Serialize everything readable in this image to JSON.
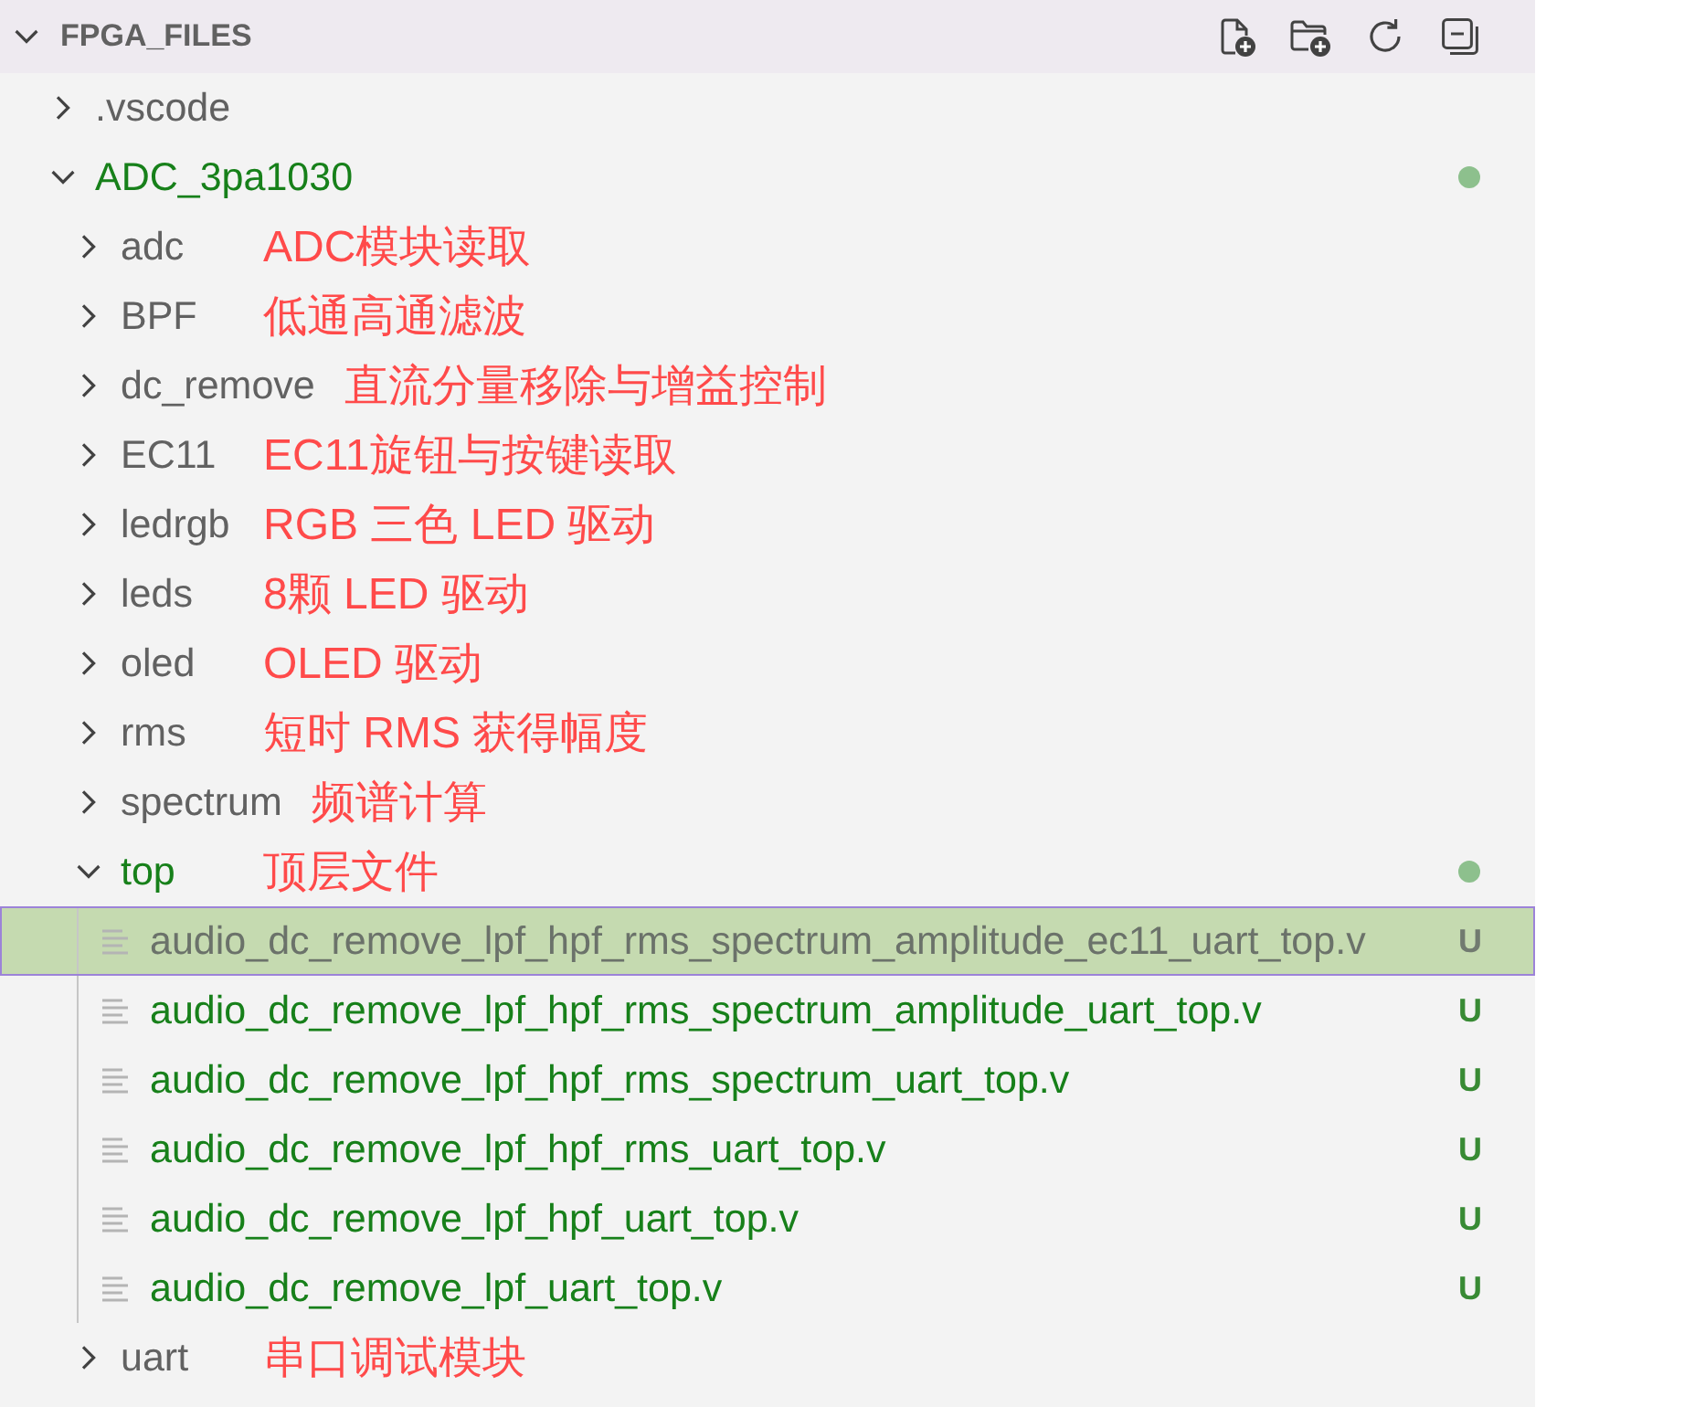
{
  "section": {
    "title": "FPGA_FILES",
    "expanded": true
  },
  "tree": [
    {
      "kind": "folder",
      "name": ".vscode",
      "expanded": false,
      "selected": false,
      "untracked": false,
      "has_changes": false
    },
    {
      "kind": "folder",
      "name": "ADC_3pa1030",
      "expanded": true,
      "selected": false,
      "untracked": true,
      "has_changes": true,
      "children": [
        {
          "kind": "folder",
          "name": "adc",
          "expanded": false,
          "selected": false,
          "untracked": false,
          "has_changes": false,
          "note": "ADC模块读取"
        },
        {
          "kind": "folder",
          "name": "BPF",
          "expanded": false,
          "selected": false,
          "untracked": false,
          "has_changes": false,
          "note": "低通高通滤波"
        },
        {
          "kind": "folder",
          "name": "dc_remove",
          "expanded": false,
          "selected": false,
          "untracked": false,
          "has_changes": false,
          "note": "直流分量移除与增益控制"
        },
        {
          "kind": "folder",
          "name": "EC11",
          "expanded": false,
          "selected": false,
          "untracked": false,
          "has_changes": false,
          "note": "EC11旋钮与按键读取"
        },
        {
          "kind": "folder",
          "name": "ledrgb",
          "expanded": false,
          "selected": false,
          "untracked": false,
          "has_changes": false,
          "note": "RGB 三色 LED 驱动"
        },
        {
          "kind": "folder",
          "name": "leds",
          "expanded": false,
          "selected": false,
          "untracked": false,
          "has_changes": false,
          "note": "8颗 LED 驱动"
        },
        {
          "kind": "folder",
          "name": "oled",
          "expanded": false,
          "selected": false,
          "untracked": false,
          "has_changes": false,
          "note": "OLED 驱动"
        },
        {
          "kind": "folder",
          "name": "rms",
          "expanded": false,
          "selected": false,
          "untracked": false,
          "has_changes": false,
          "note": "短时 RMS 获得幅度"
        },
        {
          "kind": "folder",
          "name": "spectrum",
          "expanded": false,
          "selected": false,
          "untracked": false,
          "has_changes": false,
          "note": "频谱计算"
        },
        {
          "kind": "folder",
          "name": "top",
          "expanded": true,
          "selected": false,
          "untracked": true,
          "has_changes": true,
          "note": "顶层文件",
          "children": [
            {
              "kind": "file",
              "name": "audio_dc_remove_lpf_hpf_rms_spectrum_amplitude_ec11_uart_top.v",
              "selected": true,
              "untracked": true,
              "badge": "U"
            },
            {
              "kind": "file",
              "name": "audio_dc_remove_lpf_hpf_rms_spectrum_amplitude_uart_top.v",
              "selected": false,
              "untracked": true,
              "badge": "U"
            },
            {
              "kind": "file",
              "name": "audio_dc_remove_lpf_hpf_rms_spectrum_uart_top.v",
              "selected": false,
              "untracked": true,
              "badge": "U"
            },
            {
              "kind": "file",
              "name": "audio_dc_remove_lpf_hpf_rms_uart_top.v",
              "selected": false,
              "untracked": true,
              "badge": "U"
            },
            {
              "kind": "file",
              "name": "audio_dc_remove_lpf_hpf_uart_top.v",
              "selected": false,
              "untracked": true,
              "badge": "U"
            },
            {
              "kind": "file",
              "name": "audio_dc_remove_lpf_uart_top.v",
              "selected": false,
              "untracked": true,
              "badge": "U"
            }
          ]
        },
        {
          "kind": "folder",
          "name": "uart",
          "expanded": false,
          "selected": false,
          "untracked": false,
          "has_changes": false,
          "note": "串口调试模块"
        }
      ]
    }
  ]
}
